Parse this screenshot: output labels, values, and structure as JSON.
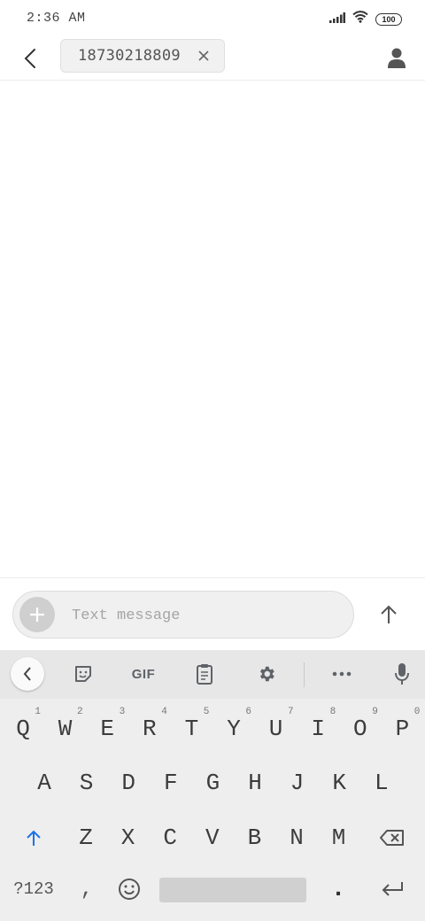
{
  "status_bar": {
    "time": "2:36 AM",
    "battery": "100",
    "icons": [
      "signal-icon",
      "wifi-icon",
      "battery-icon"
    ]
  },
  "header": {
    "back_icon": "chevron-left-icon",
    "recipient": "18730218809",
    "chip_close_icon": "close-icon",
    "contact_icon": "person-icon"
  },
  "compose": {
    "placeholder": "Text message",
    "value": "",
    "attach_icon": "plus-icon",
    "send_icon": "arrow-up-icon"
  },
  "keyboard": {
    "toolbar": {
      "collapse_icon": "chevron-left-icon",
      "sticker_icon": "sticker-icon",
      "gif_label": "GIF",
      "clipboard_icon": "clipboard-icon",
      "settings_icon": "gear-icon",
      "more_icon": "more-horizontal-icon",
      "mic_icon": "mic-icon"
    },
    "row1": [
      {
        "label": "Q",
        "hint": "1"
      },
      {
        "label": "W",
        "hint": "2"
      },
      {
        "label": "E",
        "hint": "3"
      },
      {
        "label": "R",
        "hint": "4"
      },
      {
        "label": "T",
        "hint": "5"
      },
      {
        "label": "Y",
        "hint": "6"
      },
      {
        "label": "U",
        "hint": "7"
      },
      {
        "label": "I",
        "hint": "8"
      },
      {
        "label": "O",
        "hint": "9"
      },
      {
        "label": "P",
        "hint": "0"
      }
    ],
    "row2": [
      "A",
      "S",
      "D",
      "F",
      "G",
      "H",
      "J",
      "K",
      "L"
    ],
    "row3": [
      "Z",
      "X",
      "C",
      "V",
      "B",
      "N",
      "M"
    ],
    "shift_icon": "shift-arrow-icon",
    "backspace_icon": "backspace-icon",
    "symbols_label": "?123",
    "comma_label": ",",
    "emoji_icon": "emoji-icon",
    "period_label": ".",
    "enter_icon": "enter-icon"
  },
  "colors": {
    "accent": "#1a73e8",
    "keyboard_bg": "#eeeeee",
    "toolbar_bg": "#e7e7e7"
  }
}
